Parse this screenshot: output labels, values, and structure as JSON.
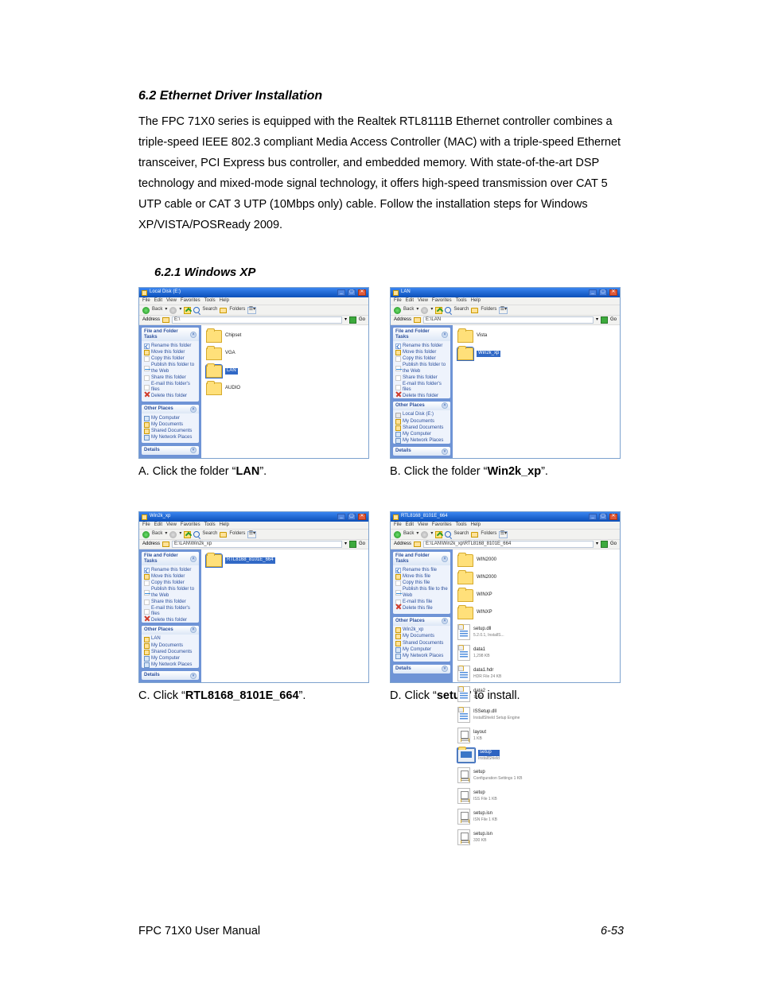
{
  "heading_6_2": "6.2   Ethernet Driver Installation",
  "para": "The FPC 71X0 series is equipped with the Realtek RTL8111B Ethernet controller combines a triple-speed IEEE 802.3 compliant Media Access Controller (MAC) with a triple-speed Ethernet transceiver, PCI Express bus controller, and embedded memory. With state-of-the-art DSP technology and mixed-mode signal technology, it offers high-speed transmission over CAT 5 UTP cable or CAT 3 UTP (10Mbps only) cable. Follow the installation steps for Windows XP/VISTA/POSReady 2009.",
  "heading_6_2_1": "6.2.1   Windows XP",
  "captions": {
    "A_pre": "A. Click the folder “",
    "A_b": "LAN",
    "A_post": "”.",
    "B_pre": "B. Click the folder “",
    "B_b": "Win2k_xp",
    "B_post": "”.",
    "C_pre": "C. Click “",
    "C_b": "RTL8168_8101E_664",
    "C_post": "”.",
    "D_pre": "D. Click “",
    "D_b": "setup",
    "D_post": "” to install."
  },
  "footer_left": "FPC 71X0 User Manual",
  "footer_right": "6-53",
  "xp_common": {
    "menus": [
      "File",
      "Edit",
      "View",
      "Favorites",
      "Tools",
      "Help"
    ],
    "back": "Back",
    "search": "Search",
    "folders": "Folders",
    "addr_label": "Address",
    "go": "Go",
    "tasks_folder_hdr": "File and Folder Tasks",
    "tasks_file_hdr": "File and Folder Tasks",
    "tasks_folder": [
      "Rename this folder",
      "Move this folder",
      "Copy this folder",
      "Publish this folder to the Web",
      "Share this folder",
      "E-mail this folder's files",
      "Delete this folder"
    ],
    "tasks_file": [
      "Rename this file",
      "Move this file",
      "Copy this file",
      "Publish this file to the Web",
      "E-mail this file",
      "Delete this file"
    ],
    "other_hdr": "Other Places",
    "details_hdr": "Details"
  },
  "win_A": {
    "title": "Local Disk (E:)",
    "addr": "E:\\",
    "other": [
      "My Computer",
      "My Documents",
      "Shared Documents",
      "My Network Places"
    ],
    "items": [
      {
        "label": "Chipset"
      },
      {
        "label": "VGA"
      },
      {
        "label": "LAN",
        "sel": true
      },
      {
        "label": "AUDIO"
      }
    ]
  },
  "win_B": {
    "title": "LAN",
    "addr": "E:\\LAN",
    "other": [
      "Local Disk (E:)",
      "My Documents",
      "Shared Documents",
      "My Computer",
      "My Network Places"
    ],
    "items": [
      {
        "label": "Vista"
      },
      {
        "label": "Win2k_xp",
        "sel": true
      }
    ]
  },
  "win_C": {
    "title": "Win2k_xp",
    "addr": "E:\\LAN\\Win2k_xp",
    "other": [
      "LAN",
      "My Documents",
      "Shared Documents",
      "My Computer",
      "My Network Places"
    ],
    "items": [
      {
        "label": "RTL8168_8101E_664",
        "sel": true
      }
    ]
  },
  "win_D": {
    "title": "RTL8168_8101E_664",
    "addr": "E:\\LAN\\Win2k_xp\\RTL8168_8101E_664",
    "other": [
      "Win2k_xp",
      "My Documents",
      "Shared Documents",
      "My Computer",
      "My Network Places"
    ],
    "items": [
      {
        "label": "WIN2000",
        "type": "folder"
      },
      {
        "label": "WIN2000",
        "type": "folder"
      },
      {
        "label": "WINXP",
        "type": "folder"
      },
      {
        "label": "WINXP",
        "type": "folder"
      },
      {
        "label": "setup.dll",
        "type": "fileblue",
        "meta": "5.2.0.1, InstallS..."
      },
      {
        "label": "data1",
        "type": "fileblue",
        "meta": "1,298 KB"
      },
      {
        "label": "data1.hdr",
        "type": "fileblue",
        "meta": "HDR File  24 KB"
      },
      {
        "label": "data2",
        "type": "fileblue",
        "meta": "1 KB"
      },
      {
        "label": "ISSetup.dll",
        "type": "fileblue",
        "meta": "InstallShield Setup Engine"
      },
      {
        "label": "layout",
        "type": "ini",
        "meta": "1 KB"
      },
      {
        "label": "setup",
        "type": "pc",
        "meta": "InstallShield",
        "sel": true
      },
      {
        "label": "setup",
        "type": "ini",
        "meta": "Configuration Settings  1 KB"
      },
      {
        "label": "setup",
        "type": "ini",
        "meta": "ISS File  1 KB"
      },
      {
        "label": "setup.isn",
        "type": "ini",
        "meta": "ISN File  1 KB"
      },
      {
        "label": "setup.isn",
        "type": "ini",
        "meta": "330 KB"
      }
    ]
  }
}
